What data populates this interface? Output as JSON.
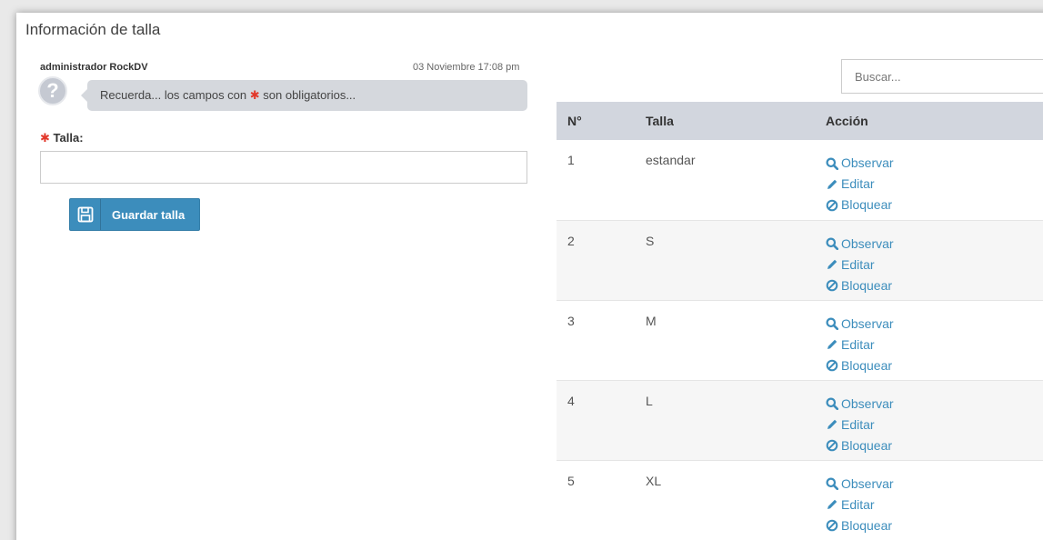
{
  "panel": {
    "title": "Información de talla"
  },
  "message": {
    "author": "administrador RockDV",
    "time": "03 Noviembre 17:08 pm",
    "avatar_glyph": "?",
    "text_before": "Recuerda... los campos con ",
    "text_after": " son obligatorios..."
  },
  "form": {
    "required_marker": "✱",
    "talla_label": "Talla:",
    "talla_value": "",
    "save_label": "Guardar talla"
  },
  "search": {
    "placeholder": "Buscar..."
  },
  "table": {
    "headers": [
      "N°",
      "Talla",
      "Acción"
    ],
    "actions": {
      "view": "Observar",
      "edit": "Editar",
      "block": "Bloquear"
    },
    "rows": [
      {
        "num": "1",
        "talla": "estandar"
      },
      {
        "num": "2",
        "talla": "S"
      },
      {
        "num": "3",
        "talla": "M"
      },
      {
        "num": "4",
        "talla": "L"
      },
      {
        "num": "5",
        "talla": "XL"
      }
    ]
  },
  "colors": {
    "accent": "#3c8dbc",
    "required": "#e2382b",
    "header_bg": "#d2d6de",
    "bubble_bg": "#d5d8dd"
  },
  "icons": {
    "avatar": "question-avatar-icon",
    "save": "floppy-disk-icon",
    "view": "magnifier-icon",
    "edit": "pencil-icon",
    "block": "ban-icon"
  }
}
